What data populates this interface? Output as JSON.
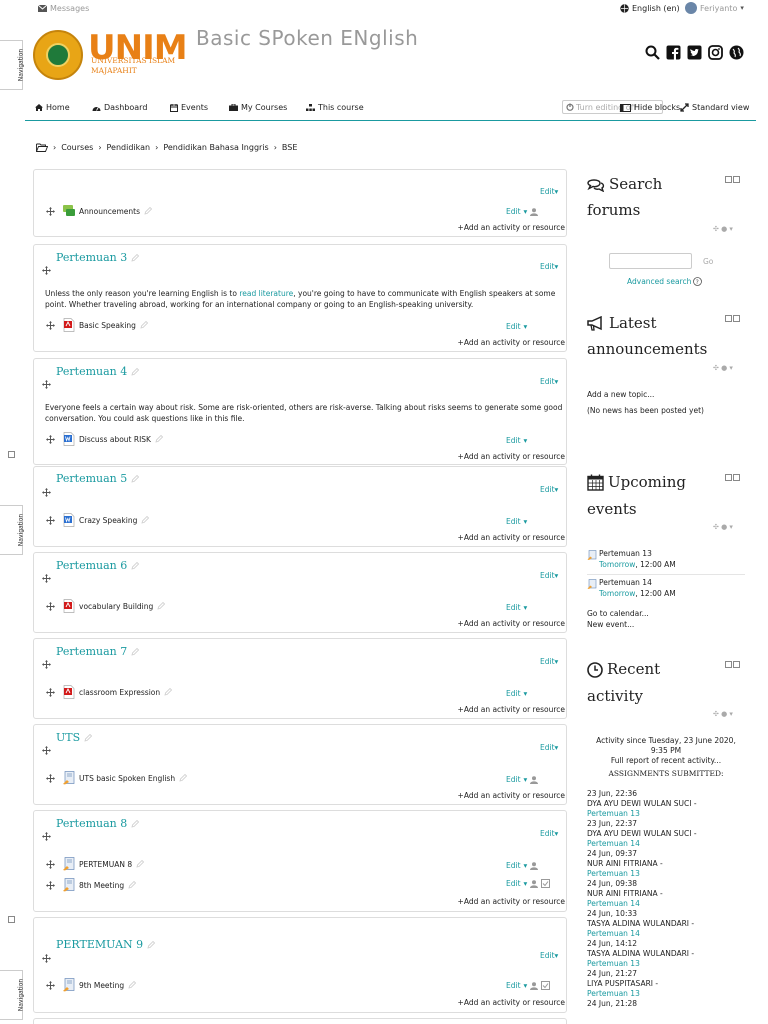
{
  "topbar": {
    "messages": "Messages",
    "language": "English (en)",
    "user": "Feriyanto"
  },
  "header": {
    "logo_word": "UNIM",
    "logo_sub1": "UNIVERSITAS ISLAM",
    "logo_sub2": "MAJAPAHIT",
    "site_title": "Basic SPoken ENglish",
    "socials": [
      "search-icon",
      "facebook-icon",
      "twitter-icon",
      "instagram-icon",
      "globe-icon"
    ]
  },
  "nav": {
    "home": "Home",
    "dashboard": "Dashboard",
    "events": "Events",
    "mycourses": "My Courses",
    "thiscourse": "This course",
    "editing": "Turn editing off",
    "hideblocks": "Hide blocks",
    "standard": "Standard view"
  },
  "sidetab": "Navigation",
  "breadcrumb": [
    "Courses",
    "Pendidikan",
    "Pendidikan Bahasa Inggris",
    "BSE"
  ],
  "common": {
    "edit": "Edit",
    "add": "Add an activity or resource"
  },
  "sections": [
    {
      "title": "",
      "text": "",
      "activities": [
        {
          "name": "Announcements",
          "type": "forum",
          "extra": "user"
        }
      ]
    },
    {
      "title": "Pertemuan 3",
      "text_pre": "Unless the only reason you're learning English is to ",
      "text_link": "read literature",
      "text_post": ", you're going to have to communicate with English speakers at some point. Whether traveling abroad, working for an international company or going to an English-speaking university.",
      "activities": [
        {
          "name": "Basic Speaking",
          "type": "pdf",
          "extra": ""
        }
      ]
    },
    {
      "title": "Pertemuan 4",
      "text": "Everyone feels a certain way about risk. Some are risk-oriented, others are risk-averse. Talking about risks seems to generate some good conversation. You could ask questions like in this file.",
      "activities": [
        {
          "name": "Discuss about RISK",
          "type": "word",
          "extra": ""
        }
      ]
    },
    {
      "title": "Pertemuan 5",
      "text": "",
      "activities": [
        {
          "name": "Crazy Speaking",
          "type": "word",
          "extra": ""
        }
      ]
    },
    {
      "title": "Pertemuan 6",
      "text": "",
      "activities": [
        {
          "name": "vocabulary Building",
          "type": "pdf",
          "extra": ""
        }
      ]
    },
    {
      "title": "Pertemuan 7",
      "text": "",
      "activities": [
        {
          "name": "classroom Expression",
          "type": "pdf",
          "extra": ""
        }
      ]
    },
    {
      "title": "UTS",
      "text": "",
      "activities": [
        {
          "name": "UTS basic Spoken English",
          "type": "assign",
          "extra": "user"
        }
      ]
    },
    {
      "title": "Pertemuan 8",
      "text": "",
      "activities": [
        {
          "name": "PERTEMUAN 8",
          "type": "assign",
          "extra": "user"
        },
        {
          "name": "8th Meeting",
          "type": "assign",
          "extra": "user-check"
        }
      ]
    },
    {
      "title": "PERTEMUAN 9",
      "text": "",
      "activities": [
        {
          "name": "9th Meeting",
          "type": "assign",
          "extra": "user-check"
        }
      ]
    }
  ],
  "blocks": {
    "search": {
      "title1": "Search",
      "title2": "forums",
      "go": "Go",
      "advanced": "Advanced search"
    },
    "news": {
      "title1": "Latest",
      "title2": "announcements",
      "add": "Add a new topic...",
      "none": "(No news has been posted yet)"
    },
    "events": {
      "title1": "Upcoming",
      "title2": "events",
      "items": [
        {
          "name": "Pertemuan 13",
          "time_label": "Tomorrow",
          "time": ", 12:00 AM"
        },
        {
          "name": "Pertemuan 14",
          "time_label": "Tomorrow",
          "time": ", 12:00 AM"
        }
      ],
      "calendar": "Go to calendar...",
      "newevent": "New event..."
    },
    "recent": {
      "title1": "Recent",
      "title2": "activity",
      "since1": "Activity since Tuesday, 23 June 2020,",
      "since2": "9:35 PM",
      "full": "Full report of recent activity...",
      "heading": "ASSIGNMENTS SUBMITTED:",
      "items": [
        {
          "date": "23 Jun, 22:36",
          "name": "DYA AYU DEWI WULAN SUCI -",
          "link": "Pertemuan 13"
        },
        {
          "date": "23 Jun, 22:37",
          "name": "DYA AYU DEWI WULAN SUCI -",
          "link": "Pertemuan 14"
        },
        {
          "date": "24 Jun, 09:37",
          "name": "NUR AINI FITRIANA -",
          "link": "Pertemuan 13"
        },
        {
          "date": "24 Jun, 09:38",
          "name": "NUR AINI FITRIANA -",
          "link": "Pertemuan 14"
        },
        {
          "date": "24 Jun, 10:33",
          "name": "TASYA ALDINA WULANDARI -",
          "link": "Pertemuan 14"
        },
        {
          "date": "24 Jun, 14:12",
          "name": "TASYA ALDINA WULANDARI -",
          "link": "Pertemuan 13"
        },
        {
          "date": "24 Jun, 21:27",
          "name": "LIYA PUSPITASARI -",
          "link": "Pertemuan 13"
        },
        {
          "date": "24 Jun, 21:28",
          "name": "",
          "link": ""
        }
      ]
    }
  }
}
